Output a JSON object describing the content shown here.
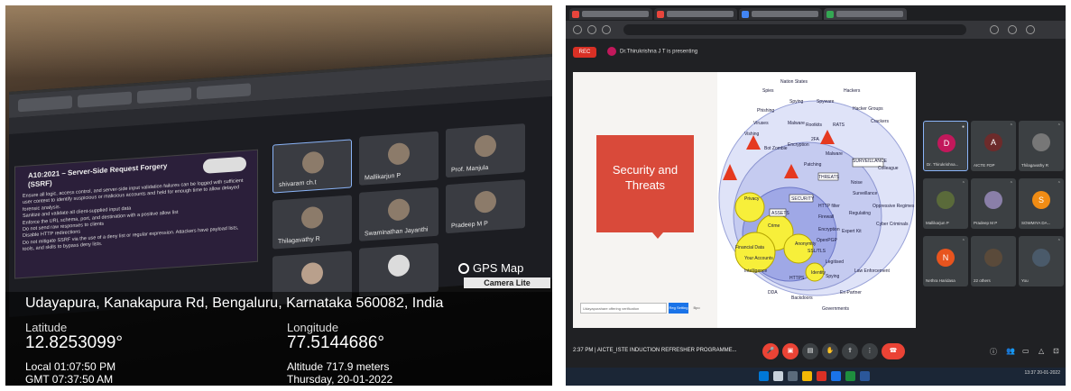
{
  "left_photo": {
    "slide": {
      "heading": "A10:2021 – Server-Side Request Forgery (SSRF)",
      "logo_text": "",
      "bullets": [
        "Ensure all logic, access control, and server-side input validation failures can be logged with sufficient user context to identify suspicious or malicious accounts and held for enough time to allow delayed forensic analysis.",
        "Sanitize and validate all client-supplied input data",
        "Enforce the URL schema, port, and destination with a positive allow list",
        "Do not send raw responses to clients",
        "Disable HTTP redirections",
        "Do not mitigate SSRF via the use of a deny list or regular expression. Attackers have payload lists, tools, and skills to bypass deny lists."
      ]
    },
    "participants": [
      {
        "name": "shivaram ch.t"
      },
      {
        "name": "Mallikarjun P"
      },
      {
        "name": "Prof. Manjula"
      },
      {
        "name": "Thilagavathy R"
      },
      {
        "name": "Swaminathan Jayanthi"
      },
      {
        "name": "Pradeep M P"
      }
    ],
    "gps_logo": {
      "line1": "GPS Map",
      "line2": "Camera Lite"
    },
    "gps": {
      "address": "Udayapura, Kanakapura Rd, Bengaluru, Karnataka 560082, India",
      "latitude_label": "Latitude",
      "latitude": "12.8253099°",
      "longitude_label": "Longitude",
      "longitude": "77.5144686°",
      "local": "Local 01:07:50 PM",
      "gmt": "GMT 07:37:50 AM",
      "altitude": "Altitude 717.9 meters",
      "date": "Thursday, 20-01-2022"
    }
  },
  "right_shot": {
    "rec_label": "REC",
    "presenting": "Dr.Thirukrishna J T is presenting",
    "slide": {
      "title_line1": "Security and",
      "title_line2": "Threats",
      "input_text": "Udayapurahare offering verification",
      "button_label": "Reg Setting",
      "button2_label": "Bpo"
    },
    "venn": {
      "labels": [
        "Nation States",
        "Spies",
        "Hackers",
        "Spying",
        "Spyware",
        "Hacker Groups",
        "Phishing",
        "Viruses",
        "Malware",
        "Rootkits",
        "RATS",
        "Crackers",
        "Vishing",
        "Bot Zombie",
        "Encryption",
        "2FA",
        "Malware",
        "SURVEILLANCE",
        "Patching",
        "THREATS",
        "Colleague",
        "Privacy",
        "Noise",
        "Surveillance",
        "Oppressive Regimes",
        "SECURITY",
        "HTTP filter",
        "Cyber Criminals",
        "Crime",
        "Anonymity",
        "ASSETS",
        "Firewall",
        "Regulating",
        "Encryption",
        "Identity",
        "OpenPGP",
        "Expert Kit",
        "SSL/TLS",
        "HTTPS",
        "Legitised",
        "Spying",
        "Law Enforcement",
        "Ex-Partner",
        "DDA",
        "Backdoors",
        "Governments",
        "Financial Data",
        "Your Accounts",
        "Intelligence"
      ]
    },
    "tiles": [
      {
        "initial": "D",
        "name": "Dr. Thirukrishna...",
        "color": "#c2185b"
      },
      {
        "initial": "A",
        "name": "AICTE FDP",
        "color": "#6d2b2b"
      },
      {
        "initial": "",
        "name": "Thilagavathy R",
        "color": "#777777"
      },
      {
        "initial": "",
        "name": "Mallikarjun P",
        "color": "#5a6a3a"
      },
      {
        "initial": "",
        "name": "Pradeep M P",
        "color": "#8a7fa8"
      },
      {
        "initial": "S",
        "name": "SOWMIYA DA...",
        "color": "#f08c14"
      },
      {
        "initial": "N",
        "name": "Nethra Haridasa",
        "color": "#e8541e"
      },
      {
        "initial": "",
        "name": "22 others",
        "color": "#5a4a3a"
      },
      {
        "initial": "",
        "name": "You",
        "color": "#4a5a6a"
      }
    ],
    "bottom": {
      "time_meeting": "2:37 PM | AICTE_ISTE INDUCTION REFRESHER PROGRAMME...",
      "end_label": "End"
    },
    "taskbar_clock": "13:37\n20-01-2022"
  }
}
